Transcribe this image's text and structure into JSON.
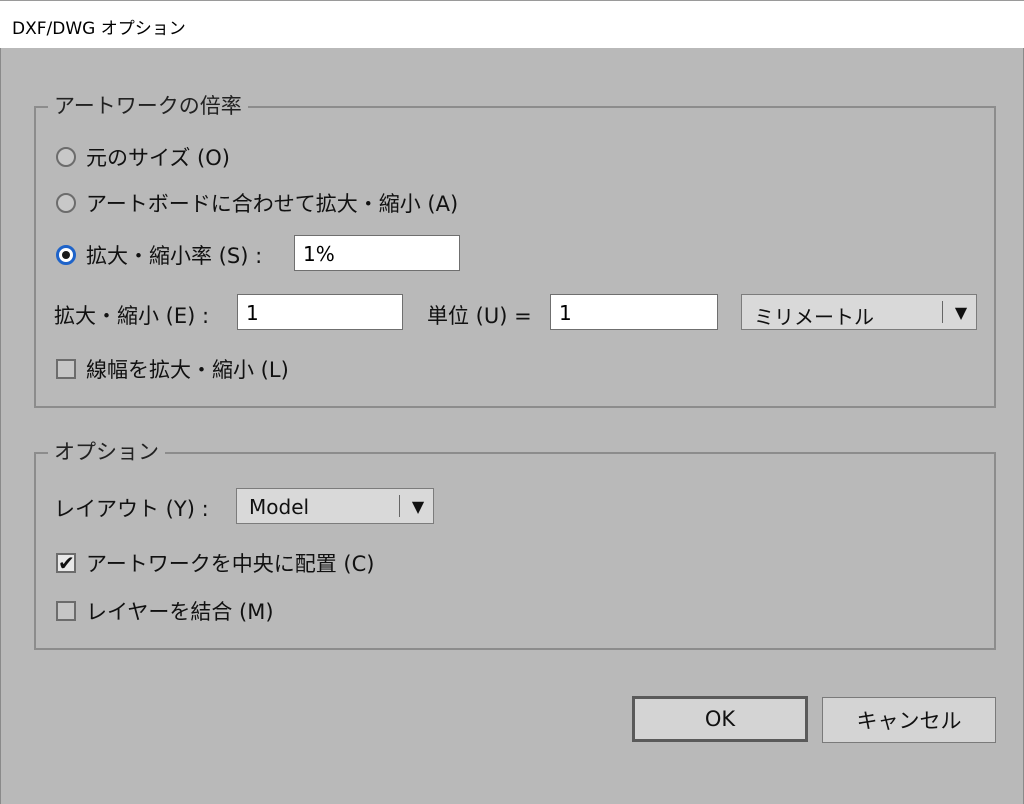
{
  "window": {
    "title": "DXF/DWG オプション"
  },
  "scale_group": {
    "legend": "アートワークの倍率",
    "options": [
      {
        "label": "元のサイズ (O)",
        "selected": false
      },
      {
        "label": "アートボードに合わせて拡大・縮小 (A)",
        "selected": false
      },
      {
        "label": "拡大・縮小率 (S) :",
        "selected": true,
        "value": "1%"
      }
    ],
    "scale_label": "拡大・縮小 (E) :",
    "scale_value": "1",
    "unit_label": "単位 (U) =",
    "unit_value": "1",
    "unit_select": {
      "selected": "ミリメートル",
      "arrow": "▼"
    },
    "scale_strokes": {
      "label": "線幅を拡大・縮小 (L)",
      "checked": false
    }
  },
  "options_group": {
    "legend": "オプション",
    "layout_label": "レイアウト (Y) :",
    "layout_select": {
      "selected": "Model",
      "arrow": "▼"
    },
    "center_artwork": {
      "label": "アートワークを中央に配置 (C)",
      "checked": true,
      "mark": "✔"
    },
    "merge_layers": {
      "label": "レイヤーを結合 (M)",
      "checked": false
    }
  },
  "buttons": {
    "ok": "OK",
    "cancel": "キャンセル"
  },
  "colors": {
    "background": "#b9b9b9",
    "radio_selected": "#1e63c9"
  }
}
